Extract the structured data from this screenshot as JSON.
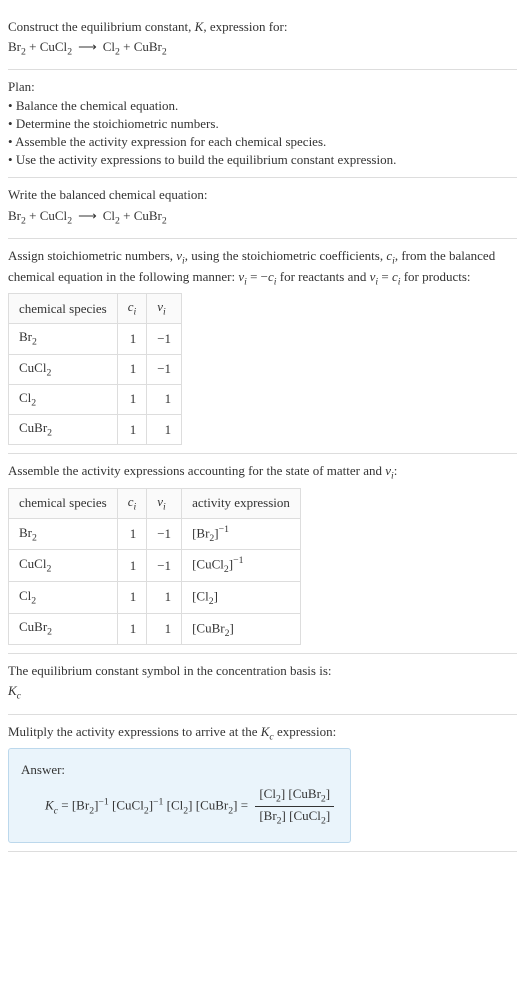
{
  "intro": {
    "line1_pre": "Construct the equilibrium constant, ",
    "K": "K",
    "line1_post": ", expression for:",
    "eq_lhs1": "Br",
    "eq_lhs1_sub": "2",
    "plus": " + ",
    "eq_lhs2": "CuCl",
    "eq_lhs2_sub": "2",
    "arrow": "⟶",
    "eq_rhs1": "Cl",
    "eq_rhs1_sub": "2",
    "eq_rhs2": "CuBr",
    "eq_rhs2_sub": "2"
  },
  "plan": {
    "title": "Plan:",
    "items": [
      "Balance the chemical equation.",
      "Determine the stoichiometric numbers.",
      "Assemble the activity expression for each chemical species.",
      "Use the activity expressions to build the equilibrium constant expression."
    ]
  },
  "balanced": {
    "title": "Write the balanced chemical equation:"
  },
  "assign": {
    "line_pre": "Assign stoichiometric numbers, ",
    "vi": "ν",
    "vi_sub": "i",
    "line_mid1": ", using the stoichiometric coefficients, ",
    "ci": "c",
    "ci_sub": "i",
    "line_mid2": ", from the balanced chemical equation in the following manner: ",
    "rel1_lhs": "ν",
    "rel1_lhs_sub": "i",
    "rel1_eq": " = −",
    "rel1_rhs": "c",
    "rel1_rhs_sub": "i",
    "line_mid3": " for reactants and ",
    "rel2_lhs": "ν",
    "rel2_lhs_sub": "i",
    "rel2_eq": " = ",
    "rel2_rhs": "c",
    "rel2_rhs_sub": "i",
    "line_post": " for products:",
    "headers": {
      "h1": "chemical species",
      "h2": "c",
      "h2_sub": "i",
      "h3": "ν",
      "h3_sub": "i"
    },
    "rows": [
      {
        "sp": "Br",
        "sp_sub": "2",
        "ci": "1",
        "vi": "−1"
      },
      {
        "sp": "CuCl",
        "sp_sub": "2",
        "ci": "1",
        "vi": "−1"
      },
      {
        "sp": "Cl",
        "sp_sub": "2",
        "ci": "1",
        "vi": "1"
      },
      {
        "sp": "CuBr",
        "sp_sub": "2",
        "ci": "1",
        "vi": "1"
      }
    ]
  },
  "activity": {
    "title_pre": "Assemble the activity expressions accounting for the state of matter and ",
    "vi": "ν",
    "vi_sub": "i",
    "title_post": ":",
    "headers": {
      "h1": "chemical species",
      "h2": "c",
      "h2_sub": "i",
      "h3": "ν",
      "h3_sub": "i",
      "h4": "activity expression"
    },
    "rows": [
      {
        "sp": "Br",
        "sp_sub": "2",
        "ci": "1",
        "vi": "−1",
        "ae_l": "[Br",
        "ae_sub": "2",
        "ae_r": "]",
        "ae_exp": "−1"
      },
      {
        "sp": "CuCl",
        "sp_sub": "2",
        "ci": "1",
        "vi": "−1",
        "ae_l": "[CuCl",
        "ae_sub": "2",
        "ae_r": "]",
        "ae_exp": "−1"
      },
      {
        "sp": "Cl",
        "sp_sub": "2",
        "ci": "1",
        "vi": "1",
        "ae_l": "[Cl",
        "ae_sub": "2",
        "ae_r": "]",
        "ae_exp": ""
      },
      {
        "sp": "CuBr",
        "sp_sub": "2",
        "ci": "1",
        "vi": "1",
        "ae_l": "[CuBr",
        "ae_sub": "2",
        "ae_r": "]",
        "ae_exp": ""
      }
    ]
  },
  "symbol": {
    "line": "The equilibrium constant symbol in the concentration basis is:",
    "Kc_K": "K",
    "Kc_c": "c"
  },
  "multiply": {
    "line_pre": "Mulitply the activity expressions to arrive at the ",
    "Kc_K": "K",
    "Kc_c": "c",
    "line_post": " expression:"
  },
  "answer": {
    "label": "Answer:",
    "Kc_K": "K",
    "Kc_c": "c",
    "eq": " = ",
    "t1_l": "[Br",
    "t1_sub": "2",
    "t1_r": "]",
    "t1_exp": "−1",
    "t2_l": " [CuCl",
    "t2_sub": "2",
    "t2_r": "]",
    "t2_exp": "−1",
    "t3_l": " [Cl",
    "t3_sub": "2",
    "t3_r": "]",
    "t4_l": " [CuBr",
    "t4_sub": "2",
    "t4_r": "] ",
    "eq2": "= ",
    "num1_l": "[Cl",
    "num1_sub": "2",
    "num1_r": "] ",
    "num2_l": "[CuBr",
    "num2_sub": "2",
    "num2_r": "]",
    "den1_l": "[Br",
    "den1_sub": "2",
    "den1_r": "] ",
    "den2_l": "[CuCl",
    "den2_sub": "2",
    "den2_r": "]"
  },
  "chart_data": {
    "type": "table",
    "tables": [
      {
        "columns": [
          "chemical species",
          "c_i",
          "ν_i"
        ],
        "rows": [
          [
            "Br2",
            1,
            -1
          ],
          [
            "CuCl2",
            1,
            -1
          ],
          [
            "Cl2",
            1,
            1
          ],
          [
            "CuBr2",
            1,
            1
          ]
        ]
      },
      {
        "columns": [
          "chemical species",
          "c_i",
          "ν_i",
          "activity expression"
        ],
        "rows": [
          [
            "Br2",
            1,
            -1,
            "[Br2]^-1"
          ],
          [
            "CuCl2",
            1,
            -1,
            "[CuCl2]^-1"
          ],
          [
            "Cl2",
            1,
            1,
            "[Cl2]"
          ],
          [
            "CuBr2",
            1,
            1,
            "[CuBr2]"
          ]
        ]
      }
    ]
  }
}
